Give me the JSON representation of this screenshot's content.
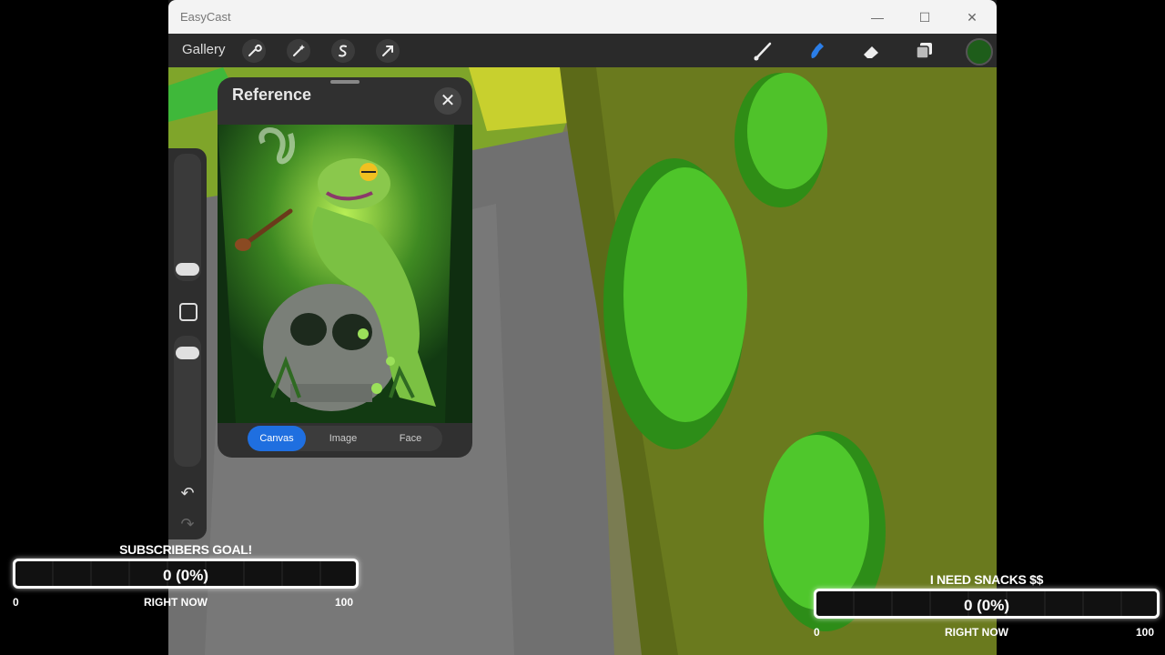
{
  "window": {
    "title": "EasyCast",
    "minimize_glyph": "—",
    "maximize_glyph": "☐",
    "close_glyph": "✕"
  },
  "toolbar": {
    "gallery_label": "Gallery",
    "left_tools": [
      "wrench-icon",
      "magic-wand-icon",
      "selection-icon",
      "transform-arrow-icon"
    ],
    "right_tools": [
      "brush-icon",
      "smudge-icon",
      "eraser-icon",
      "layers-icon"
    ],
    "active_tool": "smudge-icon",
    "active_color": "#1e5d1a",
    "accent_color": "#1f6fe0"
  },
  "sidebar": {
    "undo_glyph": "↶",
    "redo_glyph": "↷"
  },
  "reference": {
    "title": "Reference",
    "close_glyph": "✕",
    "tabs": [
      {
        "label": "Canvas",
        "active": true
      },
      {
        "label": "Image",
        "active": false
      },
      {
        "label": "Face",
        "active": false
      }
    ]
  },
  "goals": [
    {
      "title": "SUBSCRIBERS GOAL!",
      "value": "0 (0%)",
      "min": "0",
      "max": "100",
      "caption": "RIGHT NOW",
      "progress": 0
    },
    {
      "title": "I NEED SNACKS $$",
      "value": "0 (0%)",
      "min": "0",
      "max": "100",
      "caption": "RIGHT NOW",
      "progress": 0
    }
  ]
}
